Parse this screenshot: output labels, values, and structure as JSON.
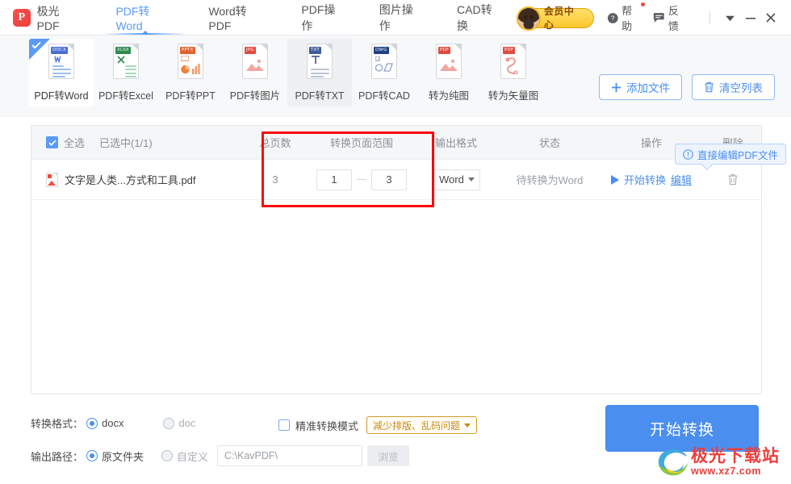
{
  "window": {
    "brand_name": "极光PDF",
    "logo_letter": "P",
    "dropdown_icon": "chevron-down-icon",
    "minimize_icon": "minimize-icon",
    "close_icon": "close-icon"
  },
  "nav": {
    "tabs": [
      {
        "label": "PDF转Word",
        "active": true
      },
      {
        "label": "Word转PDF",
        "active": false
      },
      {
        "label": "PDF操作",
        "active": false
      },
      {
        "label": "图片操作",
        "active": false
      },
      {
        "label": "CAD转换",
        "active": false
      }
    ],
    "vip_label": "会员中心",
    "help_label": "帮助",
    "feedback_label": "反馈"
  },
  "toolbar": {
    "tiles": [
      {
        "label": "PDF转Word",
        "tag": "DOCX",
        "tag_color": "#4a6fd4",
        "line_color": "#9dbef5",
        "selected": true,
        "hovered": false
      },
      {
        "label": "PDF转Excel",
        "tag": "XLSX",
        "tag_color": "#2f8a4f",
        "line_color": "#a8d8b9",
        "selected": false,
        "hovered": false
      },
      {
        "label": "PDF转PPT",
        "tag": "PPTX",
        "tag_color": "#e2622c",
        "line_color": "#f6b596",
        "selected": false,
        "hovered": false
      },
      {
        "label": "PDF转图片",
        "tag": "JPG",
        "tag_color": "#e04b3f",
        "line_color": "#f3a6a0",
        "selected": false,
        "hovered": false
      },
      {
        "label": "PDF转TXT",
        "tag": "TXT",
        "tag_color": "#3f5b9c",
        "line_color": "#b9c3d8",
        "selected": false,
        "hovered": true
      },
      {
        "label": "PDF转CAD",
        "tag": "DWG",
        "tag_color": "#1f3f86",
        "line_color": "#b6c4dd",
        "selected": false,
        "hovered": false
      },
      {
        "label": "转为纯图",
        "tag": "PDF",
        "tag_color": "#e04b3f",
        "line_color": "#f3a6a0",
        "selected": false,
        "hovered": false
      },
      {
        "label": "转为矢量图",
        "tag": "PDF",
        "tag_color": "#e04b3f",
        "line_color": "#f3a6a0",
        "selected": false,
        "hovered": false
      }
    ],
    "add_file_label": "添加文件",
    "clear_list_label": "清空列表",
    "add_icon": "plus-icon",
    "clear_icon": "trash-icon"
  },
  "list": {
    "select_all_label": "全选",
    "selected_count_label": "已选中(1/1)",
    "headers": {
      "pages": "总页数",
      "range": "转换页面范围",
      "format": "输出格式",
      "status": "状态",
      "action": "操作",
      "delete": "删除"
    },
    "rows": [
      {
        "checked": true,
        "file_icon": "pdf-file-icon",
        "file_name": "文字是人类...方式和工具.pdf",
        "pages": "3",
        "range_from": "1",
        "range_to": "3",
        "format": "Word",
        "status": "待转换为Word",
        "start_label": "开始转换",
        "edit_label": "编辑",
        "delete_icon": "trash-icon"
      }
    ],
    "tooltip": {
      "text": "直接编辑PDF文件",
      "icon": "info-icon"
    }
  },
  "footer": {
    "format_label": "转换格式：",
    "format_options": [
      {
        "label": "docx",
        "selected": true
      },
      {
        "label": "doc",
        "selected": false
      }
    ],
    "precise_mode_label": "精准转换模式",
    "precise_mode_checked": false,
    "mode_pill_label": "减少排版、乱码问题",
    "output_label": "输出路径：",
    "output_options": [
      {
        "label": "原文件夹",
        "selected": true
      },
      {
        "label": "自定义",
        "selected": false
      }
    ],
    "path_value": "C:\\KavPDF\\",
    "browse_label": "浏览",
    "start_button_label": "开始转换"
  },
  "watermark": {
    "title": "极光下载站",
    "url": "www.xz7.com"
  },
  "colors": {
    "accent": "#4a8ef0",
    "nav_active": "#5a9bf6",
    "vip_gold": "#fcc82e",
    "highlight_red": "#fb0808",
    "toolbar_bg": "#f7f8fa"
  }
}
